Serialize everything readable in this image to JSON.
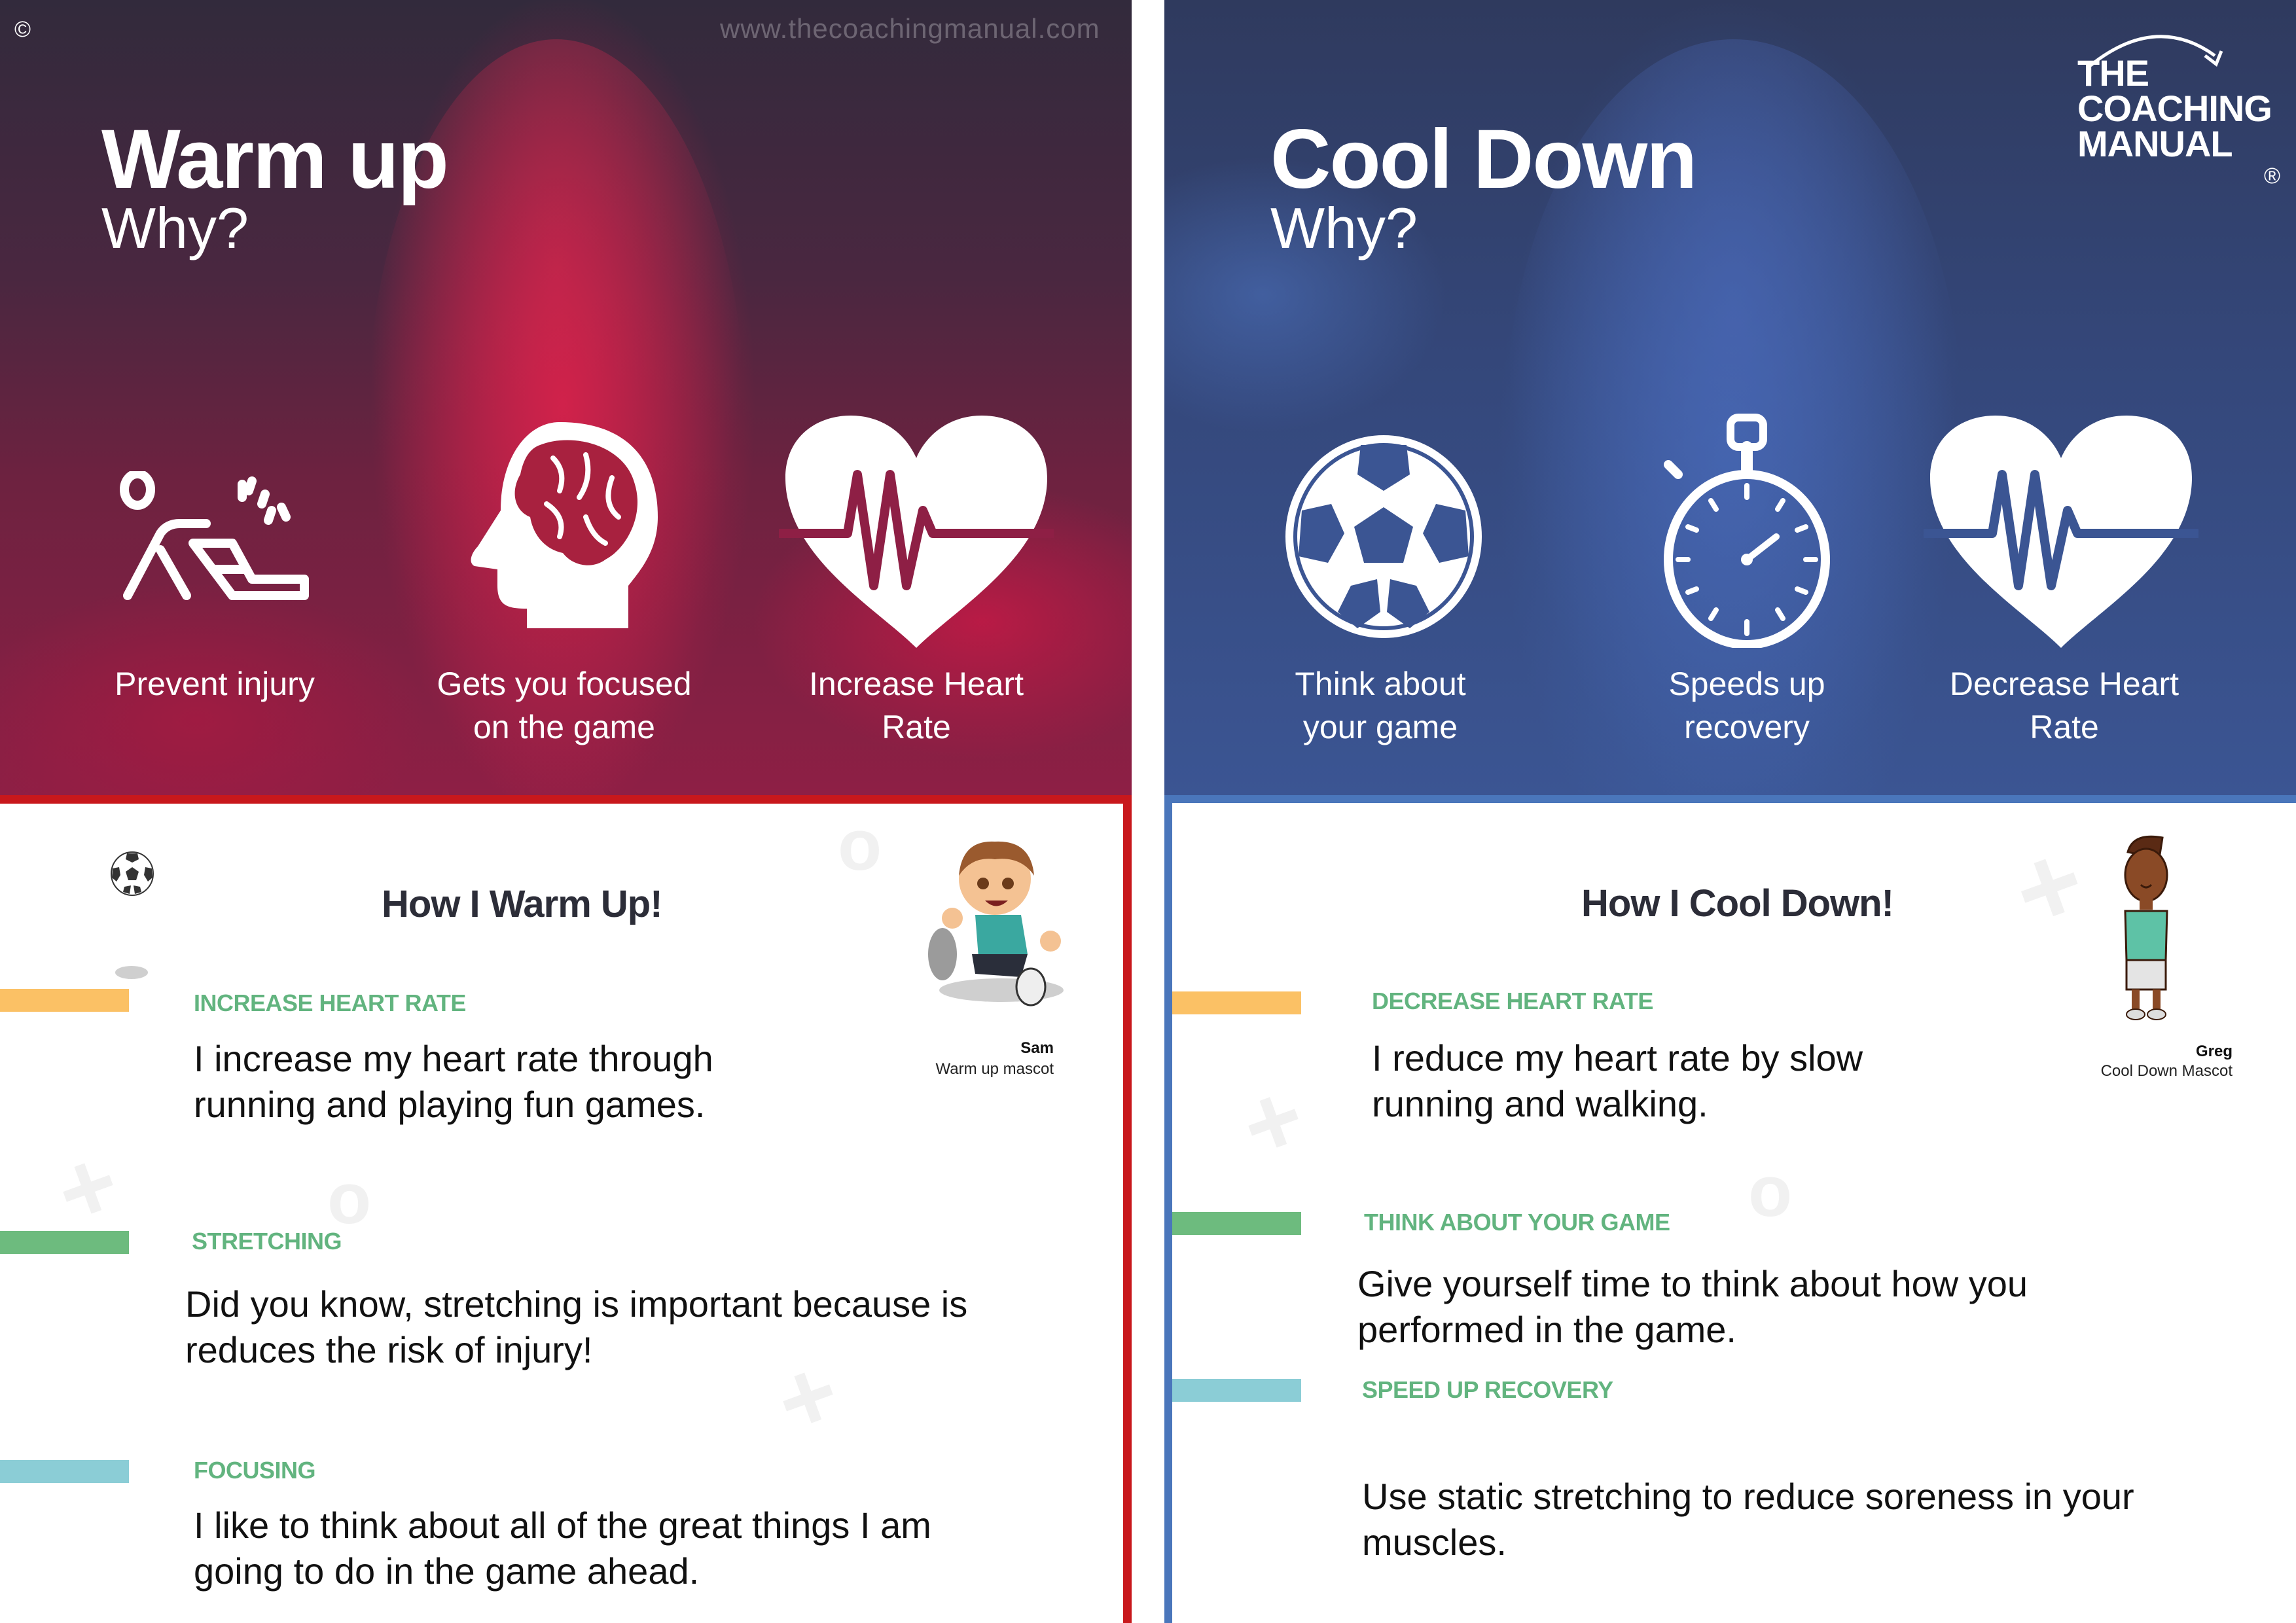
{
  "meta": {
    "copyright_symbol": "©",
    "website": "www.thecoachingmanual.com"
  },
  "logo": {
    "lines": [
      "THE",
      "COACHING",
      "MANUAL"
    ],
    "registered_symbol": "®"
  },
  "colors": {
    "warm_panel": "#8e1f45",
    "cool_panel": "#3b5593",
    "warm_border": "#c8181c",
    "cool_border": "#4a76bb",
    "heading_green": "#62b47f",
    "stripe_yellow": "#fbc165",
    "stripe_green": "#6dbb7e",
    "stripe_teal": "#8bcdd6",
    "title_dark": "#2c2d38"
  },
  "warm_up": {
    "title": "Warm up",
    "subtitle": "Why?",
    "reasons": [
      {
        "icon": "stretching-person-icon",
        "label_lines": [
          "Prevent injury"
        ]
      },
      {
        "icon": "brain-head-icon",
        "label_lines": [
          "Gets you focused",
          "on the game"
        ]
      },
      {
        "icon": "heart-rate-icon",
        "label_lines": [
          "Increase Heart",
          "Rate"
        ]
      }
    ],
    "section_title": "How I Warm Up!",
    "mascot": {
      "name": "Sam",
      "role": "Warm up mascot"
    },
    "items": [
      {
        "heading": "INCREASE HEART RATE",
        "stripe": "yellow",
        "body_lines": [
          "I increase my heart rate through",
          "running and playing fun games."
        ]
      },
      {
        "heading": "STRETCHING",
        "stripe": "green",
        "body_lines": [
          "Did you know, stretching is important because is",
          "reduces the risk of injury!"
        ]
      },
      {
        "heading": "FOCUSING",
        "stripe": "teal",
        "body_lines": [
          "I like to think about all of the great things I am",
          "going to do in the game ahead."
        ]
      }
    ]
  },
  "cool_down": {
    "title": "Cool Down",
    "subtitle": "Why?",
    "reasons": [
      {
        "icon": "soccer-ball-icon",
        "label_lines": [
          "Think about",
          "your game"
        ]
      },
      {
        "icon": "stopwatch-icon",
        "label_lines": [
          "Speeds up",
          "recovery"
        ]
      },
      {
        "icon": "heart-rate-icon",
        "label_lines": [
          "Decrease Heart",
          "Rate"
        ]
      }
    ],
    "section_title": "How I Cool Down!",
    "mascot": {
      "name": "Greg",
      "role": "Cool Down Mascot"
    },
    "items": [
      {
        "heading": "DECREASE HEART RATE",
        "stripe": "yellow",
        "body_lines": [
          "I reduce my heart rate by slow",
          "running and walking."
        ]
      },
      {
        "heading": "THINK ABOUT YOUR GAME",
        "stripe": "green",
        "body_lines": [
          "Give yourself time to think about how you",
          "performed in the game."
        ]
      },
      {
        "heading": "SPEED UP RECOVERY",
        "stripe": "teal",
        "body_lines": [
          "Use static stretching to reduce soreness in your",
          "muscles."
        ]
      }
    ]
  }
}
